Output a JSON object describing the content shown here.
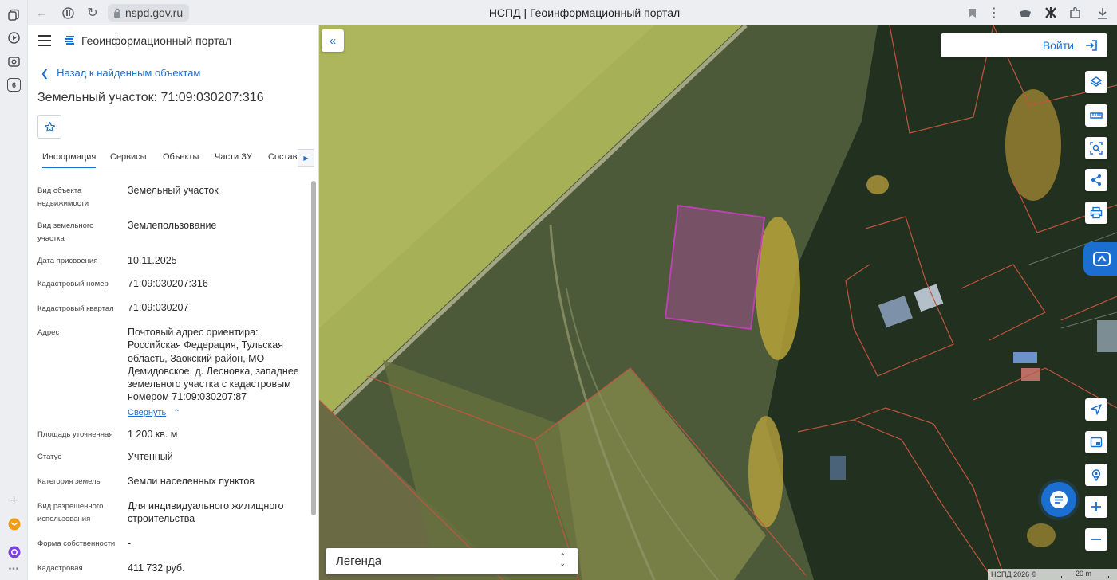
{
  "browser": {
    "url": "nspd.gov.ru",
    "tab_title": "НСПД | Геоинформационный портал"
  },
  "rail": {
    "badge": "6"
  },
  "app": {
    "name": "Геоинформационный портал",
    "back_label": "Назад к найденным объектам",
    "object_title": "Земельный участок: 71:09:030207:316"
  },
  "tabs": [
    "Информация",
    "Сервисы",
    "Объекты",
    "Части ЗУ",
    "Состав"
  ],
  "properties": [
    {
      "label": "Вид объекта недвижимости",
      "value": "Земельный участок"
    },
    {
      "label": "Вид земельного участка",
      "value": "Землепользование"
    },
    {
      "label": "Дата присвоения",
      "value": "10.11.2025"
    },
    {
      "label": "Кадастровый номер",
      "value": "71:09:030207:316"
    },
    {
      "label": "Кадастровый квартал",
      "value": "71:09:030207"
    },
    {
      "label": "Адрес",
      "value": "Почтовый адрес ориентира: Российская Федерация, Тульская область, Заокский район, МО Демидовское, д. Лесновка, западнее земельного участка с кадастровым номером 71:09:030207:87"
    },
    {
      "label": "Площадь уточненная",
      "value": "1 200 кв. м"
    },
    {
      "label": "Статус",
      "value": "Учтенный"
    },
    {
      "label": "Категория земель",
      "value": "Земли населенных пунктов"
    },
    {
      "label": "Вид разрешенного использования",
      "value": "Для индивидуального жилищного строительства"
    },
    {
      "label": "Форма собственности",
      "value": "-"
    },
    {
      "label": "Кадастровая",
      "value": "411 732 руб."
    }
  ],
  "collapse_label": "Свернуть",
  "map": {
    "login_label": "Войти",
    "legend_label": "Легенда",
    "copyright": "НСПД 2026 ©",
    "scale_label": "20 m",
    "colors": {
      "accent": "#1a6fd1",
      "parcel_border": "#c33fb8",
      "cadastre_lines": "#c0553e"
    }
  }
}
